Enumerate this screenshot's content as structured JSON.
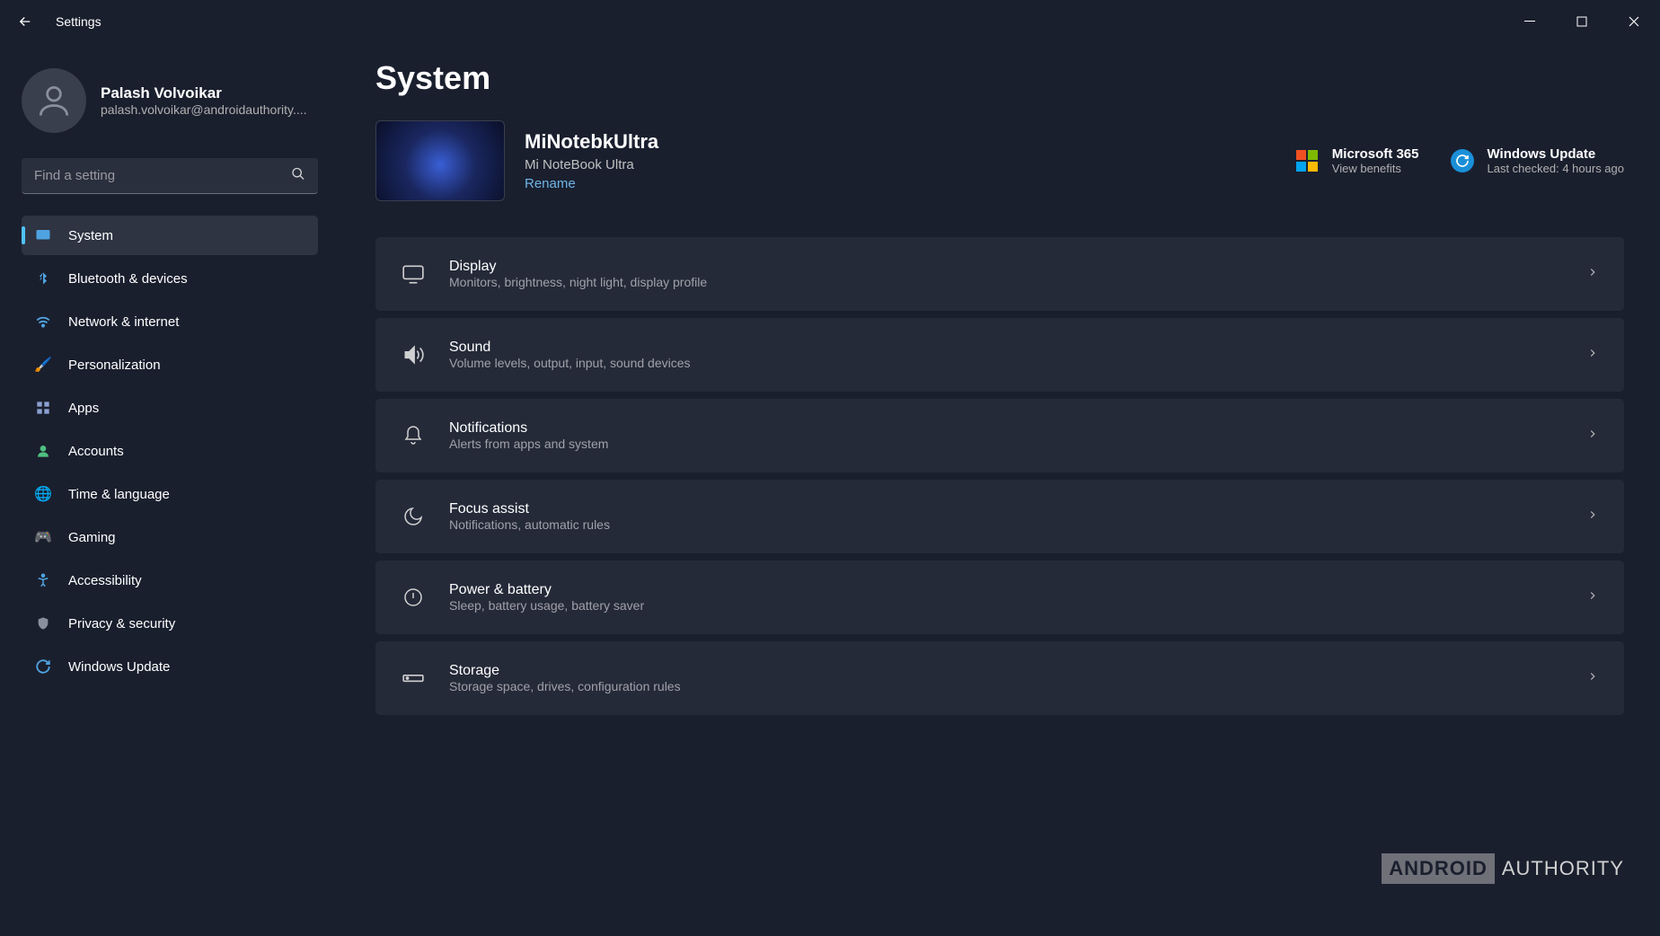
{
  "app_title": "Settings",
  "user": {
    "name": "Palash Volvoikar",
    "email": "palash.volvoikar@androidauthority...."
  },
  "search": {
    "placeholder": "Find a setting"
  },
  "sidebar": {
    "items": [
      {
        "label": "System",
        "icon": "🖥️",
        "active": true
      },
      {
        "label": "Bluetooth & devices",
        "icon": "bluetooth",
        "active": false
      },
      {
        "label": "Network & internet",
        "icon": "wifi",
        "active": false
      },
      {
        "label": "Personalization",
        "icon": "🖌️",
        "active": false
      },
      {
        "label": "Apps",
        "icon": "apps",
        "active": false
      },
      {
        "label": "Accounts",
        "icon": "👤",
        "active": false
      },
      {
        "label": "Time & language",
        "icon": "🌐",
        "active": false
      },
      {
        "label": "Gaming",
        "icon": "🎮",
        "active": false
      },
      {
        "label": "Accessibility",
        "icon": "accessibility",
        "active": false
      },
      {
        "label": "Privacy & security",
        "icon": "🛡️",
        "active": false
      },
      {
        "label": "Windows Update",
        "icon": "update",
        "active": false
      }
    ]
  },
  "page": {
    "title": "System"
  },
  "device": {
    "name": "MiNotebkUltra",
    "model": "Mi NoteBook Ultra",
    "rename_label": "Rename"
  },
  "status": {
    "m365": {
      "title": "Microsoft 365",
      "sub": "View benefits"
    },
    "update": {
      "title": "Windows Update",
      "sub": "Last checked: 4 hours ago"
    }
  },
  "settings": [
    {
      "title": "Display",
      "desc": "Monitors, brightness, night light, display profile",
      "icon": "display"
    },
    {
      "title": "Sound",
      "desc": "Volume levels, output, input, sound devices",
      "icon": "sound"
    },
    {
      "title": "Notifications",
      "desc": "Alerts from apps and system",
      "icon": "bell"
    },
    {
      "title": "Focus assist",
      "desc": "Notifications, automatic rules",
      "icon": "moon"
    },
    {
      "title": "Power & battery",
      "desc": "Sleep, battery usage, battery saver",
      "icon": "power"
    },
    {
      "title": "Storage",
      "desc": "Storage space, drives, configuration rules",
      "icon": "storage"
    }
  ],
  "watermark": {
    "box": "ANDROID",
    "text": "AUTHORITY"
  }
}
